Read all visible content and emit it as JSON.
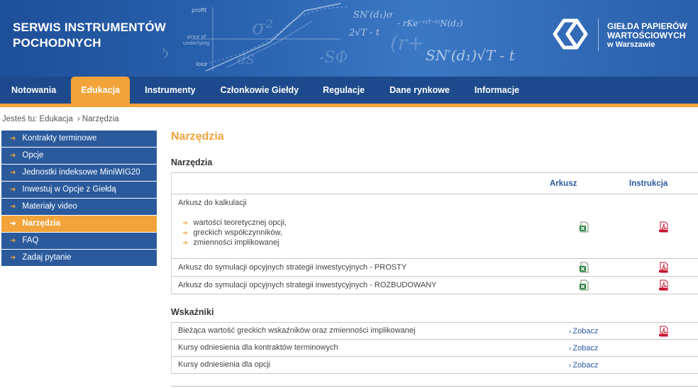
{
  "header": {
    "site_title": "SERWIS INSTRUMENTÓW POCHODNYCH",
    "exchange_name_1": "GIEŁDA PAPIERÓW",
    "exchange_name_2": "WARTOŚCIOWYCH",
    "exchange_name_3": "w Warszawie",
    "deco_labels": {
      "profit": "profit",
      "price_of_underlying_1": "price of",
      "price_of_underlying_2": "underlying",
      "loss": "loss"
    }
  },
  "nav": {
    "items": [
      {
        "label": "Notowania"
      },
      {
        "label": "Edukacja",
        "active": true
      },
      {
        "label": "Instrumenty"
      },
      {
        "label": "Członkowie Giełdy"
      },
      {
        "label": "Regulacje"
      },
      {
        "label": "Dane rynkowe"
      },
      {
        "label": "Informacje"
      }
    ]
  },
  "breadcrumb": {
    "prefix": "Jesteś tu:",
    "items": [
      "Edukacja",
      "Narzędzia"
    ],
    "separator": "›"
  },
  "sidebar": {
    "items": [
      {
        "label": "Kontrakty terminowe"
      },
      {
        "label": "Opcje"
      },
      {
        "label": "Jednostki indeksowe MiniWIG20"
      },
      {
        "label": "Inwestuj w Opcje z Giełdą"
      },
      {
        "label": "Materiały video"
      },
      {
        "label": "Narzędzia",
        "active": true
      },
      {
        "label": "FAQ"
      },
      {
        "label": "Zadaj pytanie"
      }
    ]
  },
  "main": {
    "page_title": "Narzędzia",
    "tools": {
      "title": "Narzędzia",
      "col_sheet": "Arkusz",
      "col_manual": "Instrukcja",
      "rows": [
        {
          "label": "Arkusz do kalkulacji",
          "bullets": [
            "wartości teoretycznej opcji,",
            "greckich współczynników,",
            "zmienności implikowanej"
          ]
        },
        {
          "label": "Arkusz do symulacji opcyjnych strategii inwestycyjnych - PROSTY"
        },
        {
          "label": "Arkusz do symulacji opcyjnych strategii inwestycyjnych - ROZBUDOWANY"
        }
      ]
    },
    "indicators": {
      "title": "Wskaźniki",
      "rows": [
        {
          "label": "Bieżąca wartość greckich wskaźników oraz zmienności implikowanej",
          "link": "Zobacz",
          "has_pdf": true
        },
        {
          "label": "Kursy odniesienia dla kontraktów terminowych",
          "link": "Zobacz"
        },
        {
          "label": "Kursy odniesienia dla opcji",
          "link": "Zobacz"
        }
      ]
    }
  },
  "colors": {
    "header_blue": "#2a63b0",
    "nav_blue": "#1d4a8c",
    "accent_orange": "#f2a33a",
    "sidebar_blue": "#2a5a9c",
    "excel_green": "#1f7a34",
    "pdf_red": "#c8102e"
  },
  "icons": {
    "excel": "excel-file-icon",
    "pdf": "pdf-file-icon",
    "arrow": "arrow-right-icon"
  }
}
